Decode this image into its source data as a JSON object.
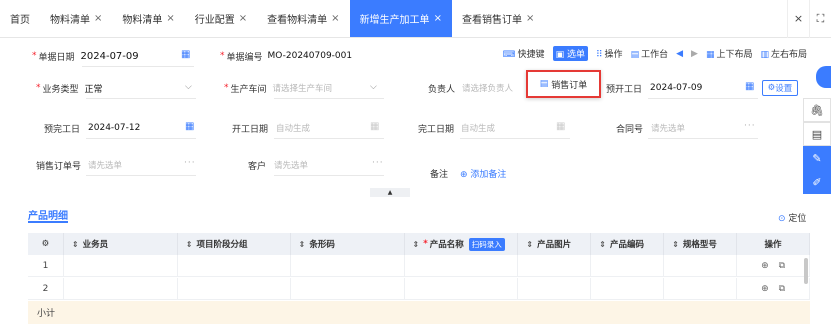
{
  "tabs": [
    {
      "label": "首页",
      "closable": false,
      "active": false
    },
    {
      "label": "物料清单",
      "closable": true,
      "active": false
    },
    {
      "label": "物料清单",
      "closable": true,
      "active": false
    },
    {
      "label": "行业配置",
      "closable": true,
      "active": false
    },
    {
      "label": "查看物料清单",
      "closable": true,
      "active": false
    },
    {
      "label": "新增生产加工单",
      "closable": true,
      "active": true
    },
    {
      "label": "查看销售订单",
      "closable": true,
      "active": false
    }
  ],
  "tab_close": "×",
  "window": {
    "close": "×",
    "fullscreen": "⛶"
  },
  "header": {
    "date_label": "单据日期",
    "date_value": "2024-07-09",
    "no_label": "单据编号",
    "no_value": "MO-20240709-001"
  },
  "toolbar": {
    "shortcut": "快捷键",
    "select": "选单",
    "operation": "操作",
    "workbench": "工作台",
    "layout_vertical": "上下布局",
    "layout_horizontal": "左右布局"
  },
  "form": {
    "biz_type_label": "业务类型",
    "biz_type_value": "正常",
    "workshop_label": "生产车间",
    "workshop_placeholder": "请选择生产车间",
    "owner_label": "负责人",
    "owner_placeholder": "请选择负责人",
    "plan_start_label": "预开工日",
    "plan_start_value": "2024-07-09",
    "settings": "设置",
    "plan_finish_label": "预完工日",
    "plan_finish_value": "2024-07-12",
    "start_label": "开工日期",
    "start_placeholder": "自动生成",
    "finish_label": "完工日期",
    "finish_placeholder": "自动生成",
    "contract_label": "合同号",
    "contract_placeholder": "请先选单",
    "so_label": "销售订单号",
    "so_placeholder": "请先选单",
    "customer_label": "客户",
    "customer_placeholder": "请先选单",
    "remark_label": "备注",
    "add_remark": "添加备注"
  },
  "popup": {
    "label": "销售订单"
  },
  "section": {
    "title": "产品明细",
    "locate": "定位"
  },
  "table": {
    "headers": [
      "业务员",
      "项目阶段分组",
      "条形码",
      "产品名称",
      "产品图片",
      "产品编码",
      "规格型号",
      "操作"
    ],
    "scan_label": "扫码录入",
    "rows": [
      "1",
      "2"
    ],
    "subtotal": "小计"
  },
  "colors": {
    "accent": "#3b7cff",
    "required": "#f5222d",
    "highlight": "#e53935",
    "subtotal_bg": "#fdf5e6"
  }
}
